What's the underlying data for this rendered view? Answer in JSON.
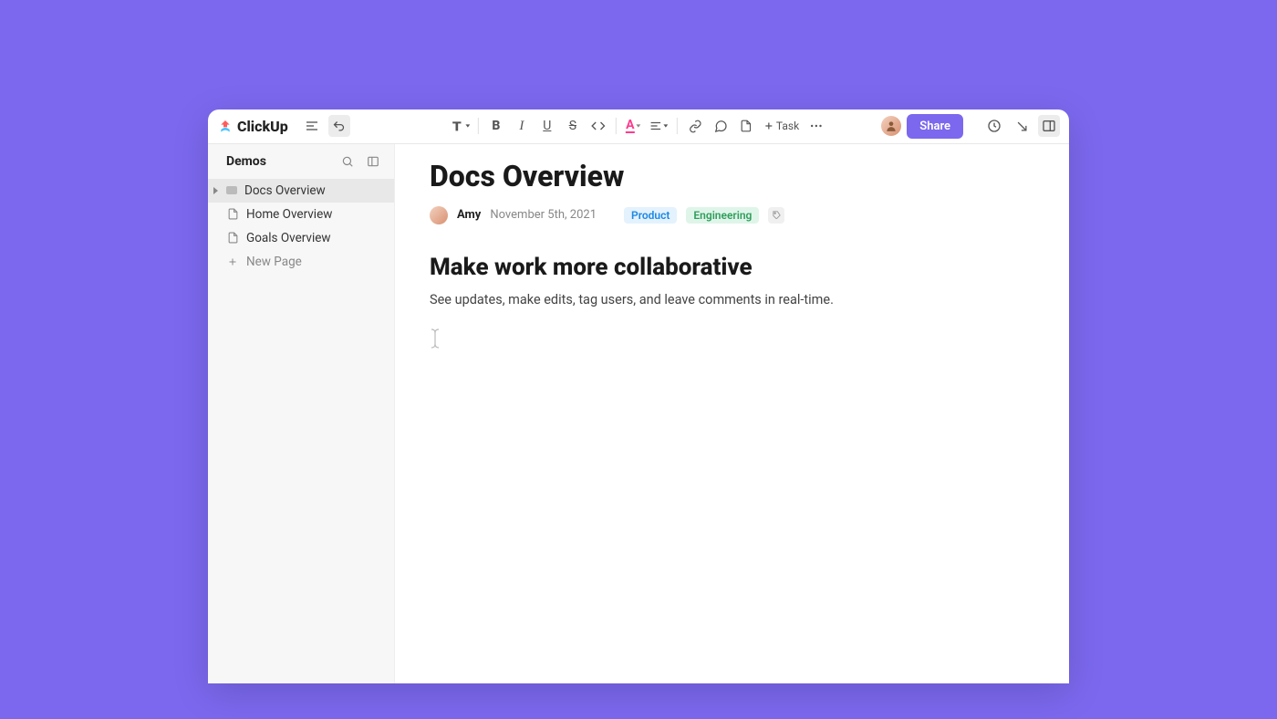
{
  "brand": {
    "name": "ClickUp"
  },
  "toolbar": {
    "task_label": "Task",
    "share_label": "Share"
  },
  "sidebar": {
    "title": "Demos",
    "items": [
      {
        "label": "Docs Overview",
        "active": true
      },
      {
        "label": "Home Overview",
        "active": false
      },
      {
        "label": "Goals Overview",
        "active": false
      }
    ],
    "new_page_label": "New Page"
  },
  "doc": {
    "title": "Docs Overview",
    "author": "Amy",
    "date": "November 5th, 2021",
    "tags": [
      {
        "label": "Product",
        "variant": "product"
      },
      {
        "label": "Engineering",
        "variant": "eng"
      }
    ],
    "heading": "Make work more collaborative",
    "paragraph": "See updates, make edits, tag users, and leave comments in real-time."
  }
}
